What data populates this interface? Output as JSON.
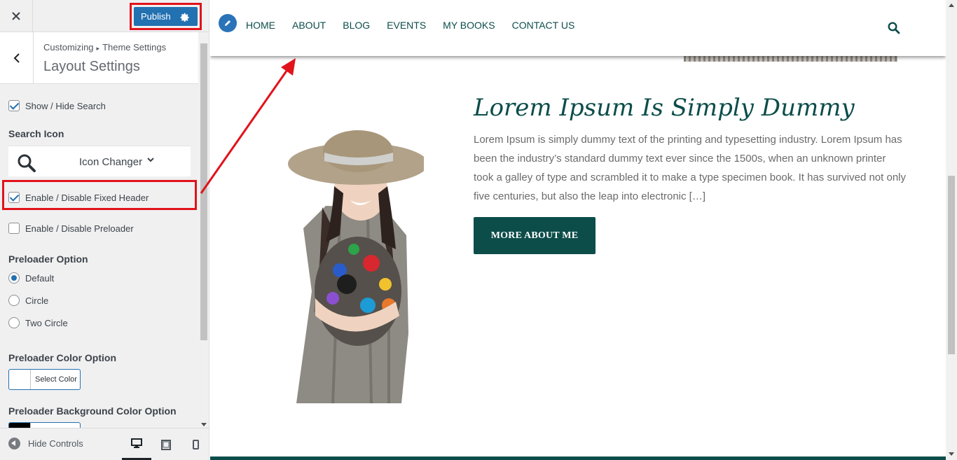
{
  "customizer": {
    "close_icon": "close-icon",
    "publish_label": "Publish",
    "breadcrumb_root": "Customizing",
    "breadcrumb_sep": "▸",
    "breadcrumb_parent": "Theme Settings",
    "section_title": "Layout Settings",
    "show_hide_search": {
      "label": "Show / Hide Search",
      "checked": true
    },
    "search_icon_label": "Search Icon",
    "icon_changer": {
      "icon": "search-icon",
      "label": "Icon Changer"
    },
    "fixed_header": {
      "label": "Enable / Disable Fixed Header",
      "checked": true
    },
    "preloader": {
      "label": "Enable / Disable Preloader",
      "checked": false
    },
    "preloader_option_label": "Preloader Option",
    "preloader_options": [
      {
        "label": "Default",
        "checked": true
      },
      {
        "label": "Circle",
        "checked": false
      },
      {
        "label": "Two Circle",
        "checked": false
      }
    ],
    "preloader_color_label": "Preloader Color Option",
    "select_color_label": "Select Color",
    "preloader_bg_color_label": "Preloader Background Color Option",
    "hide_controls_label": "Hide Controls",
    "devices": [
      "desktop",
      "tablet",
      "mobile"
    ]
  },
  "site": {
    "nav": [
      "HOME",
      "ABOUT",
      "BLOG",
      "EVENTS",
      "MY BOOKS",
      "CONTACT US"
    ],
    "post_title": "Lorem Ipsum Is Simply Dummy",
    "post_text": "Lorem Ipsum is simply dummy text of the printing and typesetting industry. Lorem Ipsum has been the industry’s standard dummy text ever since the 1500s, when an unknown printer took a galley of type and scrambled it to make a type specimen book. It has survived not only five centuries, but also the leap into electronic […]",
    "more_button": "MORE ABOUT ME"
  },
  "colors": {
    "accent": "#2271b1",
    "brand_teal": "#0c4d4a",
    "highlight_red": "#e1131b",
    "preloader_bg_swatch": "#000000"
  }
}
